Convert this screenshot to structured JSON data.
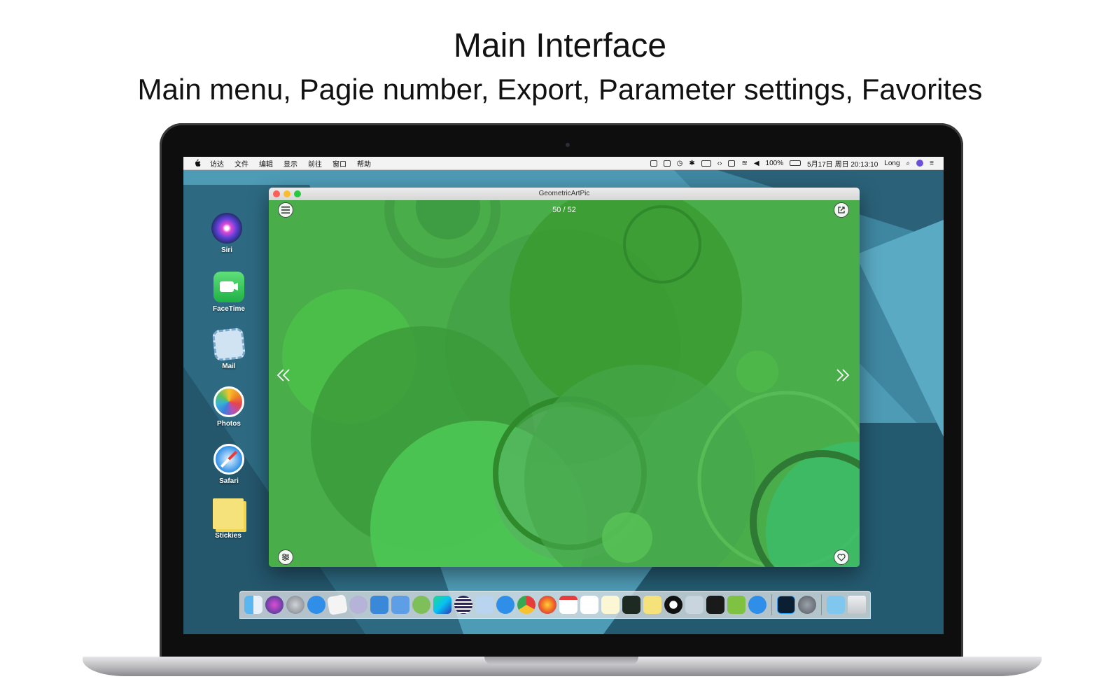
{
  "heading": {
    "title": "Main Interface",
    "subtitle": "Main menu, Pagie number, Export, Parameter settings, Favorites"
  },
  "menubar": {
    "items": [
      "访达",
      "文件",
      "编辑",
      "显示",
      "前往",
      "窗口",
      "帮助"
    ],
    "battery": "100%",
    "clock": "5月17日 周日 20:13:10",
    "user": "Long"
  },
  "desktop_icons": [
    {
      "label": "Siri"
    },
    {
      "label": "FaceTime"
    },
    {
      "label": "Mail"
    },
    {
      "label": "Photos"
    },
    {
      "label": "Safari"
    },
    {
      "label": "Stickies"
    }
  ],
  "window": {
    "title": "GeometricArtPic",
    "page_number": "50 / 52",
    "prev_icon": "double-chevron-left-icon",
    "next_icon": "double-chevron-right-icon",
    "menu_icon": "hamburger-menu-icon",
    "export_icon": "share-export-icon",
    "settings_icon": "sliders-icon",
    "favorite_icon": "heart-icon",
    "artwork_color": "#49ad4a"
  },
  "dock": {
    "apps": [
      "Finder",
      "Siri",
      "Launchpad",
      "App Store",
      "TextEdit",
      "BBEdit",
      "Xcode",
      "Simulator",
      "Android Studio",
      "WebStorm",
      "Eclipse",
      "Preview",
      "Safari",
      "Chrome",
      "Firefox",
      "Calendar",
      "Reminders",
      "Notes",
      "Activity Monitor",
      "Stickies",
      "QQ",
      "Screenshot",
      "Terminal",
      "Android",
      "Maps Pin",
      "Photoshop",
      "System Preferences",
      "Downloads",
      "Trash"
    ]
  }
}
